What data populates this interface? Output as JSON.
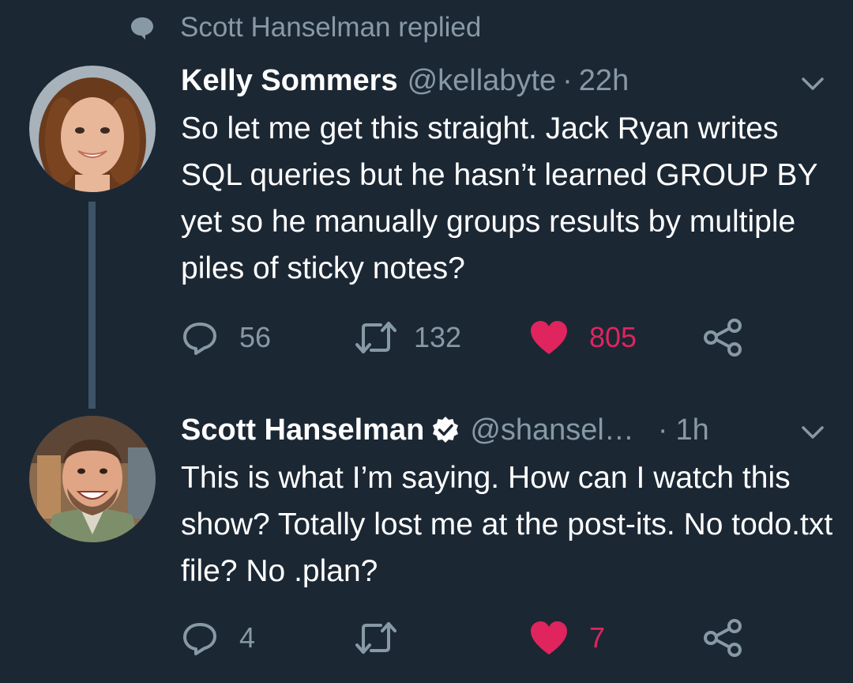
{
  "context": {
    "label": "Scott Hanselman replied"
  },
  "tweets": [
    {
      "name": "Kelly Sommers",
      "handle": "@kellabyte",
      "dot": "·",
      "time": "22h",
      "text": "So let me get this straight. Jack Ryan writes SQL queries but he hasn’t learned GROUP BY yet so he manually groups results by multiple piles of sticky notes?",
      "replies": "56",
      "retweets": "132",
      "likes": "805"
    },
    {
      "name": "Scott Hanselman",
      "handle": "@shansel…",
      "dot": "·",
      "time": "1h",
      "text": "This is what I’m saying. How can I watch this show? Totally lost me at the post-its. No todo.txt file? No .plan?",
      "replies": "4",
      "retweets": "",
      "likes": "7"
    }
  ],
  "colors": {
    "background": "#1c2734",
    "secondary_text": "#8899a6",
    "like": "#e0245e",
    "thread_line": "#3d5466"
  },
  "icons": {
    "context": "speech-bubble-icon",
    "reply": "reply-icon",
    "retweet": "retweet-icon",
    "like": "heart-icon",
    "share": "share-icon",
    "menu": "chevron-down-icon",
    "verified": "verified-badge-icon"
  }
}
